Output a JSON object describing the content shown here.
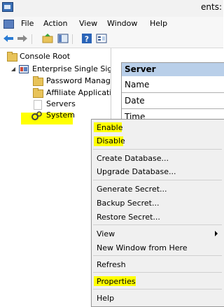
{
  "window": {
    "title_partial": "ents:"
  },
  "menubar": {
    "items": [
      "File",
      "Action",
      "View",
      "Window",
      "Help"
    ]
  },
  "toolbar": {
    "icons": [
      "back-arrow-icon",
      "forward-arrow-icon",
      "up-folder-icon",
      "show-hide-tree-icon",
      "help-icon",
      "properties-icon"
    ]
  },
  "tree": {
    "root": "Console Root",
    "enterprise": "Enterprise Single Sign",
    "items": [
      "Password Manag",
      "Affiliate Applicati",
      "Servers",
      "System"
    ]
  },
  "right_pane": {
    "header": "Server",
    "rows": [
      "Name",
      "Date",
      "Time"
    ]
  },
  "context_menu": {
    "enable": "Enable",
    "disable": "Disable",
    "create_db": "Create Database...",
    "upgrade_db": "Upgrade Database...",
    "generate_secret": "Generate Secret...",
    "backup_secret": "Backup Secret...",
    "restore_secret": "Restore Secret...",
    "view": "View",
    "new_window": "New Window from Here",
    "refresh": "Refresh",
    "properties": "Properties",
    "help": "Help"
  },
  "colors": {
    "highlight": "#ffff00",
    "header_blue": "#b9cfe9"
  }
}
